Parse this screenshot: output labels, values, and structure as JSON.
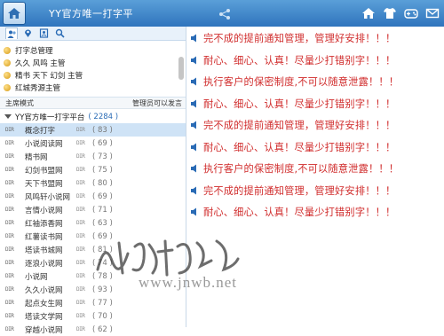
{
  "window": {
    "title": "YY官方唯一打字平",
    "icons": [
      "home-icon",
      "share-icon",
      "skin-icon",
      "game-icon",
      "mail-icon"
    ]
  },
  "sidebar": {
    "tabs": [
      "people-icon",
      "location-icon",
      "contacts-icon",
      "search-icon"
    ],
    "admins": [
      {
        "text": "打字总管理"
      },
      {
        "text": "久久 风鸣 主管"
      },
      {
        "text": "精书 天下 幻剑 主管"
      },
      {
        "text": "红城秀源主管"
      }
    ],
    "mode_label": "主席模式",
    "mode_hint": "管理员可以发言",
    "root_channel": {
      "name": "YY官方唯一打字平台",
      "count": "( 2284 )"
    },
    "channels": [
      {
        "toggle": "DIR",
        "name": "概念打字",
        "toggle2": "DIR",
        "count": "( 83 )"
      },
      {
        "toggle": "DIR",
        "name": "小说阅读网",
        "toggle2": "DIR",
        "count": "( 69 )"
      },
      {
        "toggle": "DIR",
        "name": "精书网",
        "toggle2": "DIR",
        "count": "( 73 )"
      },
      {
        "toggle": "DIR",
        "name": "幻剑书盟网",
        "toggle2": "DIR",
        "count": "( 75 )"
      },
      {
        "toggle": "DIR",
        "name": "天下书盟网",
        "toggle2": "DIR",
        "count": "( 80 )"
      },
      {
        "toggle": "DIR",
        "name": "风鸣轩小说网",
        "toggle2": "DIR",
        "count": "( 69 )"
      },
      {
        "toggle": "DIR",
        "name": "言情小说网",
        "toggle2": "DIR",
        "count": "( 71 )"
      },
      {
        "toggle": "DIR",
        "name": "红袖添香网",
        "toggle2": "DIR",
        "count": "( 63 )"
      },
      {
        "toggle": "DIR",
        "name": "红薯读书网",
        "toggle2": "DIR",
        "count": "( 69 )"
      },
      {
        "toggle": "DIR",
        "name": "塔读书城网",
        "toggle2": "DIR",
        "count": "( 81 )"
      },
      {
        "toggle": "DIR",
        "name": "逐浪小说网",
        "toggle2": "DIR",
        "count": "( 74 )"
      },
      {
        "toggle": "DIR",
        "name": "小说网",
        "toggle2": "DIR",
        "count": "( 78 )"
      },
      {
        "toggle": "DIR",
        "name": "久久小说网",
        "toggle2": "DIR",
        "count": "( 93 )"
      },
      {
        "toggle": "DIR",
        "name": "起点女生网",
        "toggle2": "DIR",
        "count": "( 77 )"
      },
      {
        "toggle": "DIR",
        "name": "塔读文学网",
        "toggle2": "DIR",
        "count": "( 70 )"
      },
      {
        "toggle": "DIR",
        "name": "穿越小说网",
        "toggle2": "DIR",
        "count": "( 62 )"
      }
    ]
  },
  "messages": [
    "完不成的提前通知管理，管理好安排！！！",
    "耐心、细心、认真！尽量少打错别字！！！",
    "执行客户的保密制度,不可以随意泄露！！！",
    "耐心、细心、认真！尽量少打错别字！！！",
    "完不成的提前通知管理，管理好安排！！！",
    "耐心、细心、认真！尽量少打错别字！！！",
    "执行客户的保密制度,不可以随意泄露！！！",
    "完不成的提前通知管理，管理好安排！！！",
    "耐心、细心、认真！尽量少打错别字！！！"
  ],
  "watermark": {
    "script": "",
    "url": "www.jnwb.net"
  },
  "colors": {
    "titlebar": "#2f74bd",
    "message_text": "#d02b2b",
    "bullet": "#2a6bb5",
    "selection": "#cfe3f6"
  }
}
